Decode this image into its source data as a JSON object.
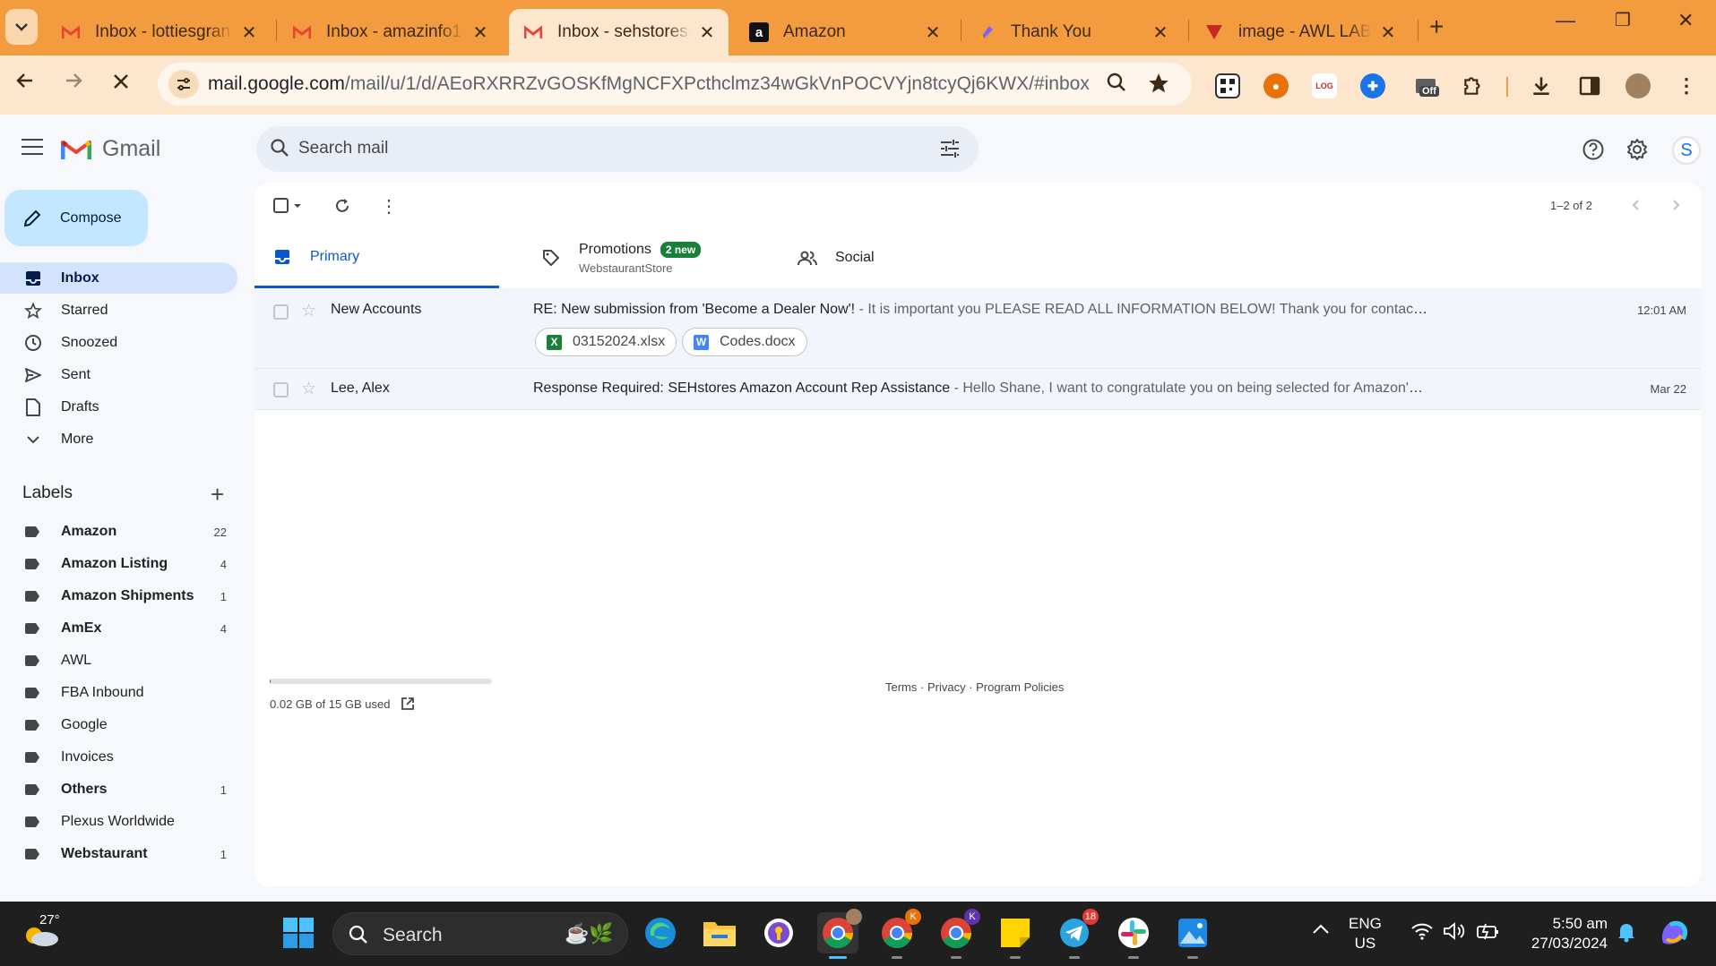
{
  "browser": {
    "tabs": [
      {
        "title": "Inbox - lottiesgran",
        "icon": "gmail-icon",
        "active": false
      },
      {
        "title": "Inbox - amazinfo1",
        "icon": "gmail-icon",
        "active": false
      },
      {
        "title": "Inbox - sehstores@",
        "icon": "gmail-icon",
        "active": true
      },
      {
        "title": "Amazon",
        "icon": "amazon-icon",
        "active": false
      },
      {
        "title": "Thank You",
        "icon": "form-icon",
        "active": false
      },
      {
        "title": "image - AWL LABE",
        "icon": "awl-icon",
        "active": false
      }
    ],
    "url_host": "mail.google.com",
    "url_path": "/mail/u/1/d/AEoRXRRZvGOSKfMgNCFXPcthclmz34wGkVnPOCVYjn8tcyQj6KWX/#inbox",
    "extension_badge": "Off"
  },
  "gmail": {
    "brand": "Gmail",
    "search_placeholder": "Search mail",
    "avatar_letter": "S",
    "compose_label": "Compose",
    "nav": [
      {
        "label": "Inbox",
        "icon": "inbox-icon",
        "active": true
      },
      {
        "label": "Starred",
        "icon": "star-icon",
        "active": false
      },
      {
        "label": "Snoozed",
        "icon": "clock-icon",
        "active": false
      },
      {
        "label": "Sent",
        "icon": "send-icon",
        "active": false
      },
      {
        "label": "Drafts",
        "icon": "draft-icon",
        "active": false
      },
      {
        "label": "More",
        "icon": "chevron-down-icon",
        "active": false
      }
    ],
    "labels_heading": "Labels",
    "labels": [
      {
        "name": "Amazon",
        "count": "22",
        "bold": true
      },
      {
        "name": "Amazon Listing",
        "count": "4",
        "bold": true
      },
      {
        "name": "Amazon Shipments",
        "count": "1",
        "bold": true
      },
      {
        "name": "AmEx",
        "count": "4",
        "bold": true
      },
      {
        "name": "AWL",
        "count": "",
        "bold": false
      },
      {
        "name": "FBA Inbound",
        "count": "",
        "bold": false
      },
      {
        "name": "Google",
        "count": "",
        "bold": false
      },
      {
        "name": "Invoices",
        "count": "",
        "bold": false
      },
      {
        "name": "Others",
        "count": "1",
        "bold": true
      },
      {
        "name": "Plexus Worldwide",
        "count": "",
        "bold": false
      },
      {
        "name": "Webstaurant",
        "count": "1",
        "bold": true
      }
    ],
    "pager": "1–2 of 2",
    "tabs": {
      "primary": "Primary",
      "promotions": "Promotions",
      "promotions_badge": "2 new",
      "promotions_sub": "WebstaurantStore",
      "social": "Social"
    },
    "emails": [
      {
        "sender": "New Accounts",
        "subject": "RE: New submission from 'Become a Dealer Now'!",
        "snippet": " - It is important you PLEASE READ ALL INFORMATION BELOW! Thank you for contacting Blue Ridge Knives, Inc. Al...",
        "date": "12:01 AM",
        "attachments": [
          {
            "name": "03152024.xlsx",
            "type": "X",
            "color": "#188038"
          },
          {
            "name": "Codes.docx",
            "type": "W",
            "color": "#4285f4"
          }
        ]
      },
      {
        "sender": "Lee, Alex",
        "subject": "Response Required: SEHstores Amazon Account Rep Assistance",
        "snippet": " - Hello Shane, I want to congratulate you on being selected for Amazon's complimentary Account R...",
        "date": "Mar 22",
        "attachments": []
      }
    ],
    "storage_text": "0.02 GB of 15 GB used",
    "storage_used_fraction": 0.0013,
    "footer": {
      "terms": "Terms",
      "privacy": "Privacy",
      "policies": "Program Policies"
    }
  },
  "taskbar": {
    "weather_temp": "27°",
    "search_label": "Search",
    "lang_top": "ENG",
    "lang_bottom": "US",
    "time": "5:50 am",
    "date": "27/03/2024",
    "telegram_badge": "18",
    "chrome_profile_k": "K"
  },
  "colors": {
    "chrome_frame": "#f39b3f",
    "chrome_toolbar": "#fce6cd",
    "gmail_bg": "#f6f8fc",
    "compose": "#c2e7ff",
    "active_nav": "#d3e3fd",
    "primary_blue": "#0b57d0",
    "badge_green": "#188038"
  }
}
